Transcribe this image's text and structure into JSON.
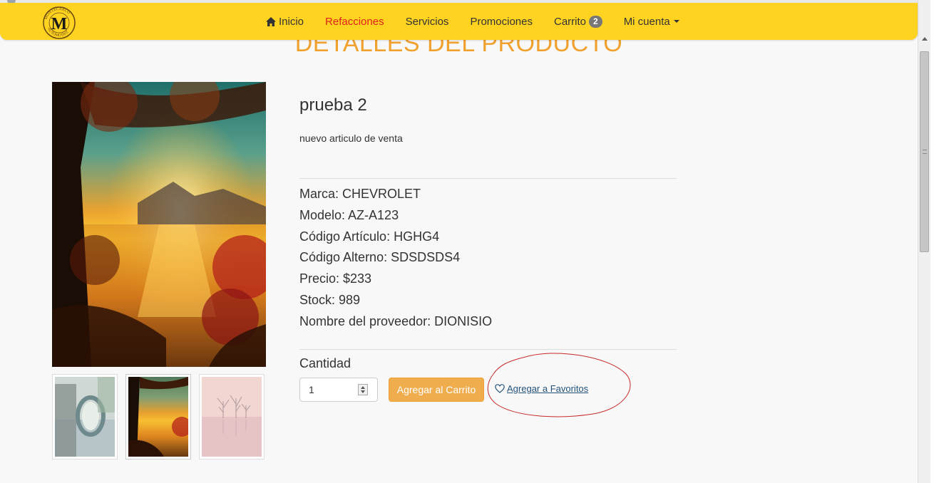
{
  "navbar": {
    "brand": "MONTECARLO AUTOMOTRIZ",
    "brand_initial": "M",
    "items": [
      {
        "label": "Inicio",
        "icon": "home-icon",
        "active": false
      },
      {
        "label": "Refacciones",
        "active": true
      },
      {
        "label": "Servicios",
        "active": false
      },
      {
        "label": "Promociones",
        "active": false
      },
      {
        "label": "Carrito",
        "badge": "2",
        "active": false
      },
      {
        "label": "Mi cuenta",
        "icon": "caret-down-icon",
        "active": false
      }
    ]
  },
  "page_heading": "DETALLES DEL PRODUCTO",
  "product": {
    "title": "prueba 2",
    "description": "nuevo articulo de venta",
    "specs": [
      "Marca: CHEVROLET",
      "Modelo: AZ-A123",
      "Código Artículo: HGHG4",
      "Código Alterno: SDSDSDS4",
      "Precio: $233",
      "Stock: 989",
      "Nombre del proveedor: DIONISIO"
    ]
  },
  "purchase": {
    "quantity_label": "Cantidad",
    "quantity_value": "1",
    "add_to_cart_label": "Agregar al Carrito",
    "add_to_favorites_label": "Agregar a Favoritos"
  },
  "gallery": {
    "thumbnails": [
      "bridge-reflection",
      "autumn-lake-sunset",
      "misty-trees"
    ],
    "selected_index": 1
  },
  "colors": {
    "navbar_bg": "#ffd31f",
    "active_nav": "#e0221b",
    "heading": "#f0a12e",
    "button": "#f0ad4e",
    "link": "#23527c",
    "annotation": "#c62828"
  }
}
